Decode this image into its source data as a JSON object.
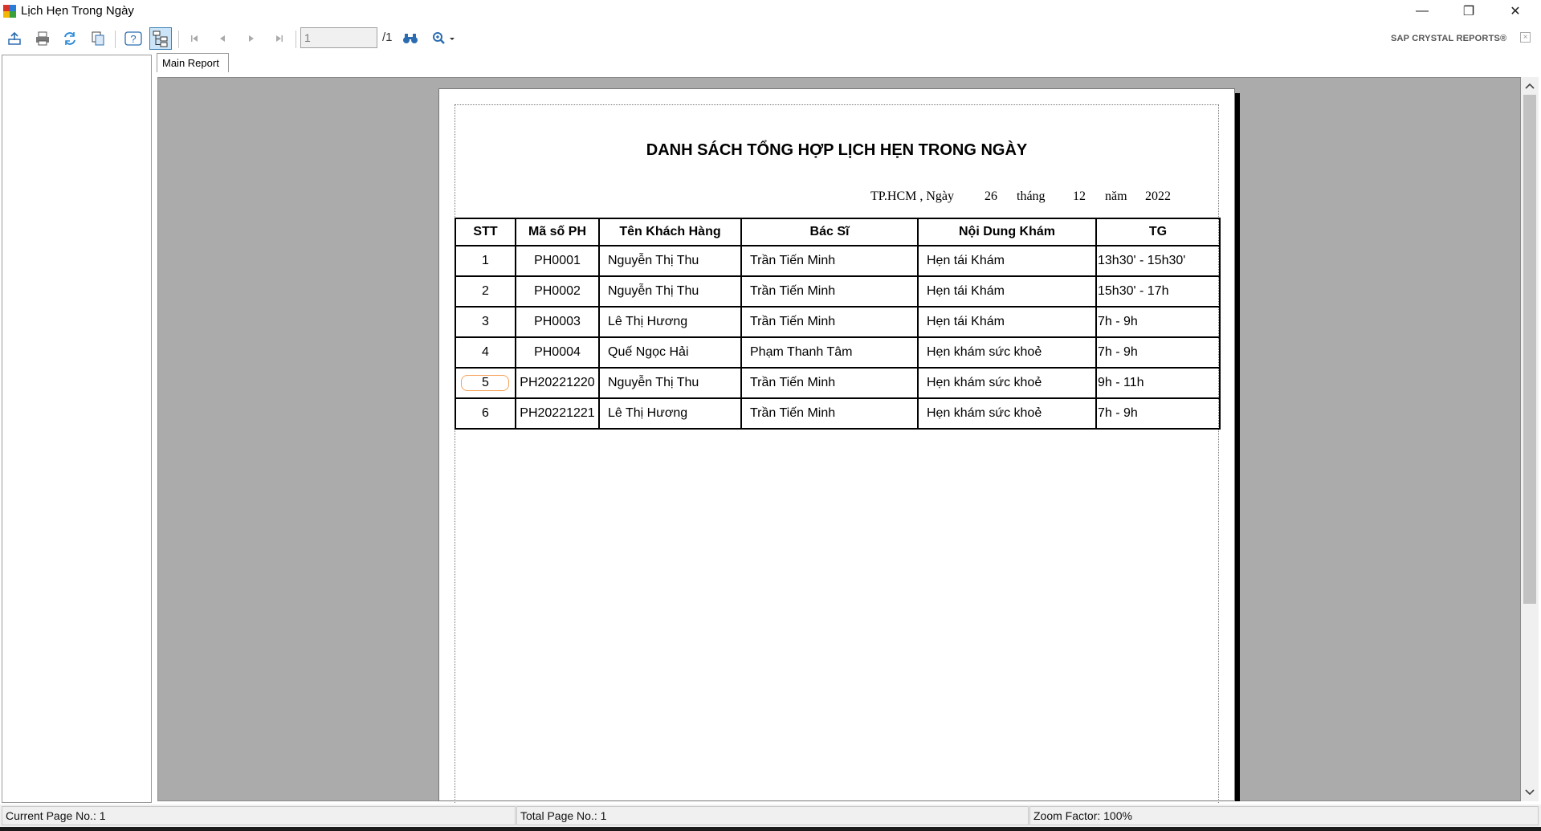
{
  "window": {
    "title": "Lịch Hẹn Trong Ngày",
    "minimize_icon": "—",
    "maximize_icon": "❐",
    "close_icon": "✕"
  },
  "toolbar": {
    "page_value": "1",
    "page_total": "/1",
    "brand": "SAP CRYSTAL REPORTS®",
    "brand_close": "×"
  },
  "tabs": [
    {
      "label": "Main Report"
    }
  ],
  "report": {
    "title": "DANH SÁCH TỔNG HỢP LỊCH HẸN TRONG NGÀY",
    "date": {
      "place": "TP.HCM , Ngày",
      "day": "26",
      "month_label": "tháng",
      "month": "12",
      "year_label": "năm",
      "year": "2022"
    },
    "columns": [
      "STT",
      "Mã số PH",
      "Tên Khách Hàng",
      "Bác Sĩ",
      "Nội Dung Khám",
      "TG"
    ],
    "rows": [
      {
        "stt": "1",
        "ma": "PH0001",
        "khach": "Nguyễn Thị Thu",
        "bacsi": "Trần Tiến Minh",
        "noidung": "Hẹn tái Khám",
        "tg": "13h30' - 15h30'"
      },
      {
        "stt": "2",
        "ma": "PH0002",
        "khach": "Nguyễn Thị Thu",
        "bacsi": "Trần Tiến Minh",
        "noidung": "Hẹn tái Khám",
        "tg": "15h30' - 17h"
      },
      {
        "stt": "3",
        "ma": "PH0003",
        "khach": "Lê Thị Hương",
        "bacsi": "Trần Tiến Minh",
        "noidung": "Hẹn tái Khám",
        "tg": "7h - 9h"
      },
      {
        "stt": "4",
        "ma": "PH0004",
        "khach": "Quế Ngọc Hải",
        "bacsi": "Phạm Thanh Tâm",
        "noidung": "Hẹn khám sức khoẻ",
        "tg": "7h - 9h"
      },
      {
        "stt": "5",
        "ma": "PH20221220",
        "khach": "Nguyễn Thị Thu",
        "bacsi": "Trần Tiến Minh",
        "noidung": "Hẹn khám sức khoẻ",
        "tg": "9h - 11h"
      },
      {
        "stt": "6",
        "ma": "PH20221221",
        "khach": "Lê Thị Hương",
        "bacsi": "Trần Tiến Minh",
        "noidung": "Hẹn khám sức khoẻ",
        "tg": "7h - 9h"
      }
    ]
  },
  "status": {
    "current_page": "Current Page No.: 1",
    "total_page": "Total Page No.: 1",
    "zoom": "Zoom Factor: 100%"
  }
}
